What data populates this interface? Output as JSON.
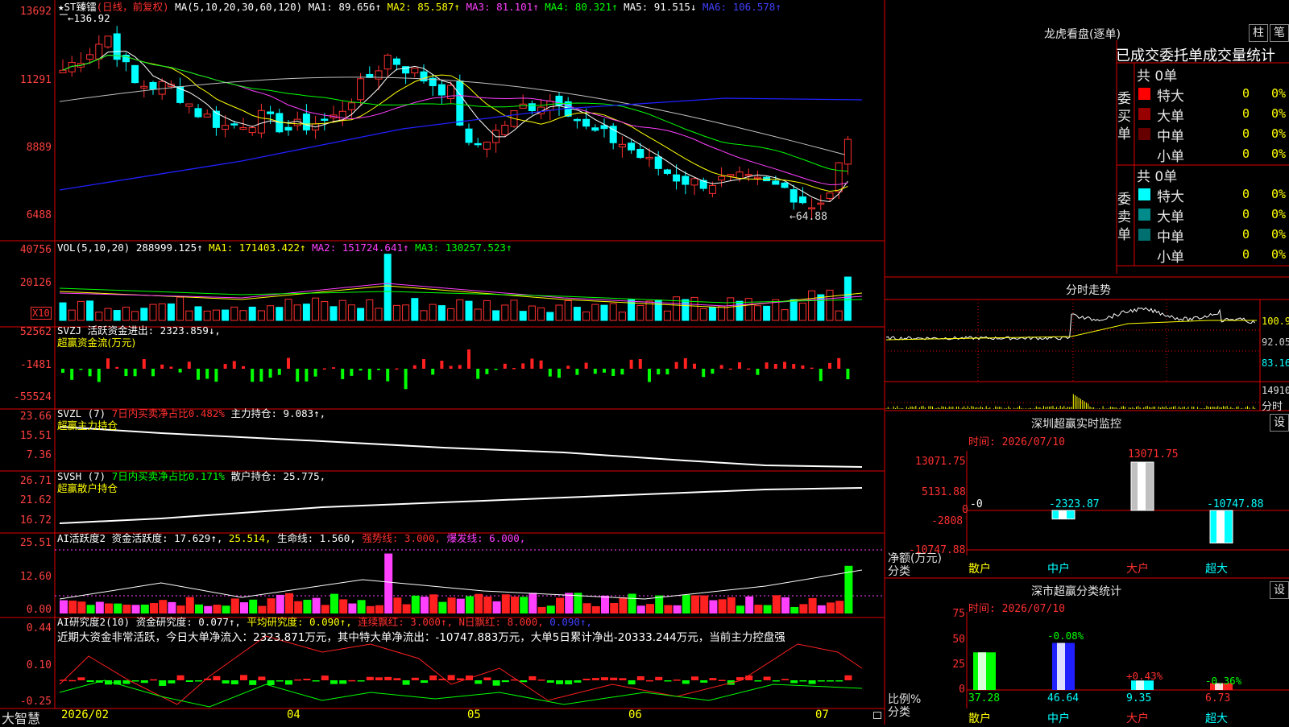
{
  "main": {
    "stock": "★ST臻镭",
    "period": "(日线，前复权)",
    "ma_params": "MA(5,10,20,30,60,120)",
    "ma_values": [
      "MA1: 89.656↑",
      "MA2: 85.587↑",
      "MA3: 81.101↑",
      "MA4: 80.321↑",
      "MA5: 91.515↓",
      "MA6: 106.578↑"
    ],
    "y_labels": [
      "13692",
      "11291",
      "8889",
      "6488"
    ],
    "high_marker": "←136.92",
    "low_marker": "←64.88",
    "colors": {
      "up": "#ff3030",
      "down": "#00ffff",
      "ma1": "#ffffff",
      "ma2": "#ffff00",
      "ma3": "#ff40ff",
      "ma4": "#00ff00",
      "ma5": "#c0c0c0",
      "ma6": "#2020ff"
    }
  },
  "vol": {
    "header": "VOL(5,10,20)",
    "value": "288999.125↑",
    "ma1": "MA1: 171403.422↑",
    "ma2": "MA2: 151724.641↑",
    "ma3": "MA3: 130257.523↑",
    "y_labels": [
      "40756",
      "20126"
    ],
    "unit": "X10"
  },
  "svzj": {
    "header": "SVZJ  活跃资金进出: 2323.859↓,",
    "sub": "超赢资金流(万元)",
    "y_labels": [
      "52562",
      "-1481",
      "-55524"
    ]
  },
  "svzl": {
    "header_a": "SVZL (7)",
    "header_b": "7日内买卖净占比0.482%",
    "header_c": "主力持仓: 9.083↑,",
    "sub": "超赢主力持仓",
    "y_labels": [
      "23.66",
      "15.51",
      "7.36"
    ]
  },
  "svsh": {
    "header_a": "SVSH (7)",
    "header_b": "7日内买卖净占比0.171%",
    "header_c": "散户持仓: 25.775,",
    "sub": "超赢散户持仓",
    "y_labels": [
      "26.71",
      "21.62",
      "16.72"
    ]
  },
  "ai_active": {
    "header": "AI活跃度2",
    "a": "资金活跃度: 17.629↑,",
    "b": "25.514,",
    "c": "生命线: 1.560,",
    "d": "强势线: 3.000,",
    "e": "爆发线: 6.000,",
    "y_labels": [
      "25.51",
      "12.60",
      "0.00"
    ]
  },
  "ai_research": {
    "header": "AI研究度2(10)",
    "a": "资金研究度: 0.077↑,",
    "b": "平均研究度: 0.090↑,",
    "c": "连续飘红: 3.000↑,",
    "d": "N日飘红: 8.000,",
    "e": "0.090↑,",
    "note": "近期大资金非常活跃，今日大单净流入：2323.871万元，其中特大单净流出：-10747.883万元，大单5日累计净出-20333.244万元，当前主力控盘强",
    "y_labels": [
      "0.44",
      "0.10",
      "-0.25"
    ]
  },
  "x_axis": {
    "brand": "大智慧",
    "labels": [
      "2026/02",
      "04",
      "05",
      "06",
      "07"
    ]
  },
  "dragon": {
    "title": "龙虎看盘(逐单)",
    "btn_zhu": "柱",
    "btn_bi": "笔",
    "subtitle": "已成交委托单成交量统计",
    "buy_label": "委买单",
    "sell_label": "委卖单",
    "buy_total": "共 0单",
    "sell_total": "共 0单",
    "buy_rows": [
      {
        "name": "特大",
        "count": "0",
        "pct": "0%",
        "color": "#ff0000"
      },
      {
        "name": "大单",
        "count": "0",
        "pct": "0%",
        "color": "#990000"
      },
      {
        "name": "中单",
        "count": "0",
        "pct": "0%",
        "color": "#660000"
      },
      {
        "name": "小单",
        "count": "0",
        "pct": "0%",
        "color": ""
      }
    ],
    "sell_rows": [
      {
        "name": "特大",
        "count": "0",
        "pct": "0%",
        "color": "#00ffff"
      },
      {
        "name": "大单",
        "count": "0",
        "pct": "0%",
        "color": "#008b8b"
      },
      {
        "name": "中单",
        "count": "0",
        "pct": "0%",
        "color": "#006f6f"
      },
      {
        "name": "小单",
        "count": "0",
        "pct": "0%",
        "color": ""
      }
    ]
  },
  "intraday": {
    "title": "分时走势",
    "y_labels": [
      "100.9",
      "92.05",
      "83.16",
      "14910",
      "分时"
    ]
  },
  "monitor": {
    "title": "深圳超赢实时监控",
    "btn": "设",
    "time": "时间: 2026/07/10",
    "y_labels": [
      "13071.75",
      "5131.88",
      "0",
      "-2808",
      "-10747.88"
    ],
    "y_title": "净额(万元)",
    "x_title": "分类",
    "categories": [
      "散户",
      "中户",
      "大户",
      "超大"
    ],
    "values": [
      0,
      -2323.87,
      13071.75,
      -10747.88
    ],
    "value_labels": [
      "-0",
      "-2323.87",
      "13071.75",
      "-10747.88"
    ]
  },
  "classify": {
    "title": "深市超赢分类统计",
    "btn": "设",
    "time": "时间: 2026/07/10",
    "y_labels": [
      "75",
      "50",
      "25",
      "0"
    ],
    "y_title": "比例%",
    "x_title": "分类",
    "categories": [
      "散户",
      "中户",
      "大户",
      "超大"
    ],
    "values": [
      37.28,
      46.64,
      9.35,
      6.73
    ],
    "value_labels": [
      "37.28",
      "46.64",
      "9.35",
      "6.73"
    ],
    "change_labels": [
      "",
      "-0.08%",
      "+0.43%",
      "-0.36%"
    ]
  }
}
